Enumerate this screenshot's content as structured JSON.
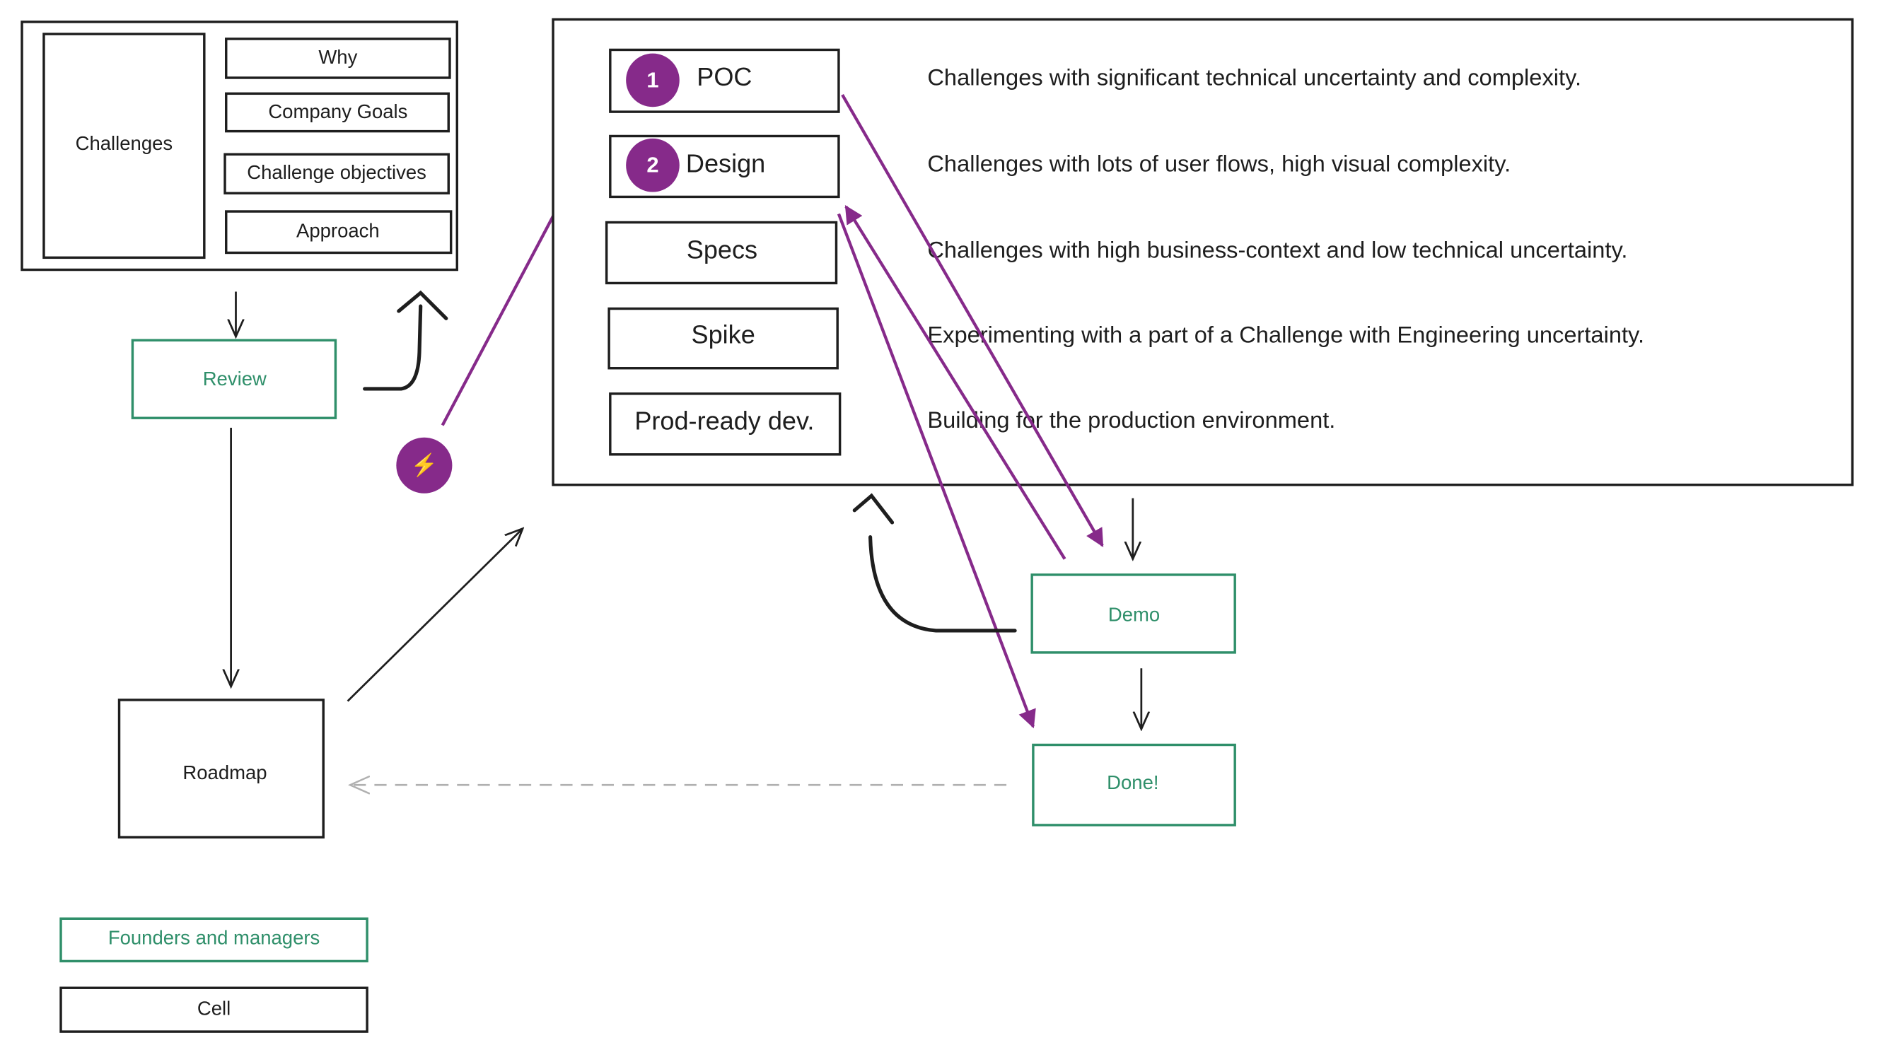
{
  "colors": {
    "ink": "#1e1e1e",
    "green": "#2f8f6a",
    "purple": "#862a8a",
    "dashed": "#b0b0b0",
    "bolt": "#f5c542"
  },
  "challenges": {
    "title": "Challenges",
    "items": [
      "Why",
      "Company Goals",
      "Challenge objectives",
      "Approach"
    ]
  },
  "flow": {
    "review": "Review",
    "roadmap": "Roadmap",
    "demo": "Demo",
    "done": "Done!"
  },
  "lightning": {
    "icon": "lightning-bolt-icon",
    "glyph": "⚡"
  },
  "types": [
    {
      "label": "POC",
      "badge": "1",
      "description": "Challenges with significant technical uncertainty and complexity."
    },
    {
      "label": "Design",
      "badge": "2",
      "description": "Challenges with lots of user flows, high visual complexity."
    },
    {
      "label": "Specs",
      "description": "Challenges with high business-context and low technical uncertainty."
    },
    {
      "label": "Spike",
      "description": "Experimenting with a part of a Challenge with Engineering uncertainty."
    },
    {
      "label": "Prod-ready dev.",
      "description": "Building for the production environment."
    }
  ],
  "legend": {
    "founders": "Founders and managers",
    "cell": "Cell"
  }
}
